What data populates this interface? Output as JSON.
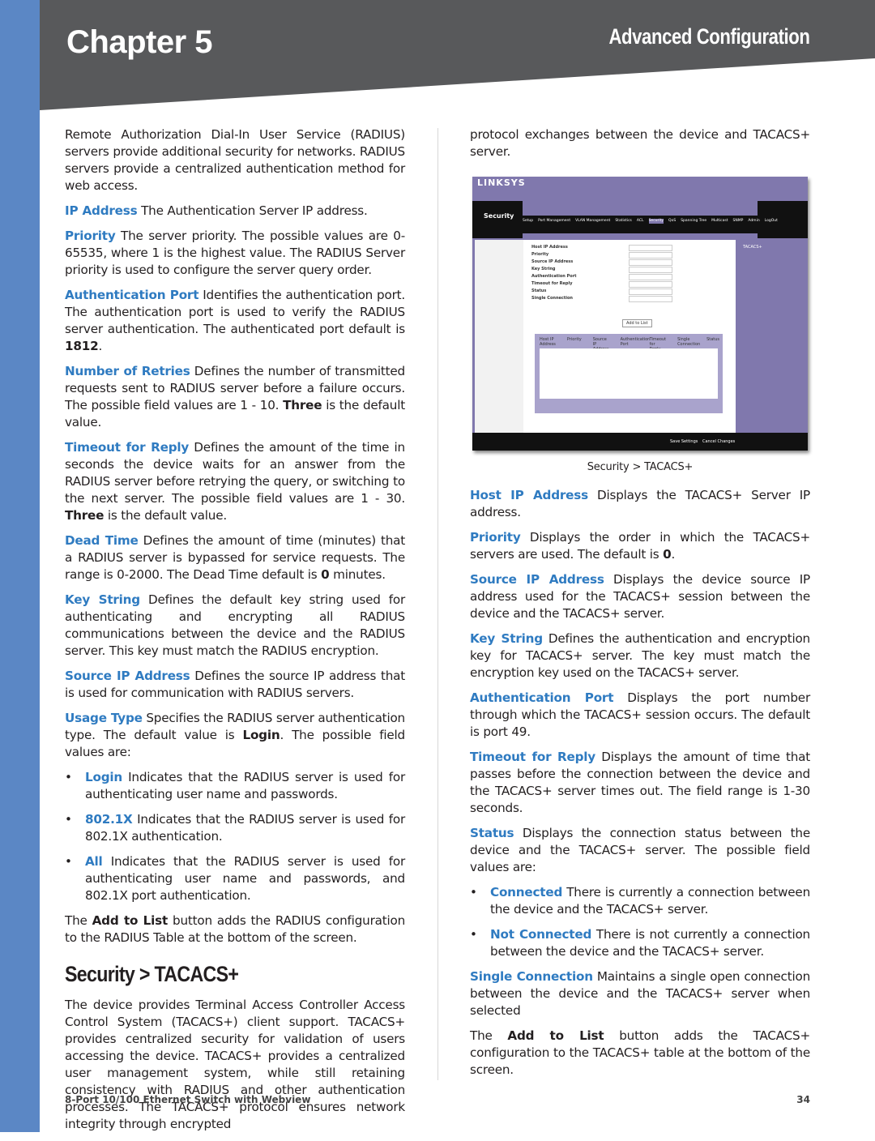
{
  "colors": {
    "strip": "#5b87c5",
    "header": "#58595b",
    "term": "#2f7bc1",
    "embedded_ui": "#8078ad"
  },
  "header": {
    "chapter": "Chapter 5",
    "section": "Advanced Configuration"
  },
  "left": [
    {
      "type": "p",
      "parts": [
        {
          "t": "Remote Authorization Dial-In User Service (RADIUS) servers provide additional security for networks. RADIUS servers provide a centralized authentication method for web access."
        }
      ]
    },
    {
      "type": "p",
      "parts": [
        {
          "t": "IP Address",
          "s": "term"
        },
        {
          "t": "  The Authentication Server IP address."
        }
      ]
    },
    {
      "type": "p",
      "parts": [
        {
          "t": "Priority",
          "s": "term"
        },
        {
          "t": "  The server priority. The possible values are 0-65535, where 1 is the highest value. The RADIUS Server priority is used to configure the server query order."
        }
      ]
    },
    {
      "type": "p",
      "parts": [
        {
          "t": "Authentication Port",
          "s": "term"
        },
        {
          "t": "  Identifies the authentication port. The authentication port is used to verify the RADIUS server authentication. The authenticated port default is "
        },
        {
          "t": "1812",
          "s": "b"
        },
        {
          "t": "."
        }
      ]
    },
    {
      "type": "p",
      "parts": [
        {
          "t": "Number of Retries",
          "s": "term"
        },
        {
          "t": "  Defines the number of transmitted requests sent to RADIUS server before a failure occurs. The possible field values are 1 - 10. "
        },
        {
          "t": "Three",
          "s": "b"
        },
        {
          "t": " is the default value."
        }
      ]
    },
    {
      "type": "p",
      "parts": [
        {
          "t": "Timeout for Reply",
          "s": "term"
        },
        {
          "t": "  Defines the amount of the time in seconds the device waits for an answer from the RADIUS server before retrying the query, or switching to the next server. The possible field values are 1 - 30. "
        },
        {
          "t": "Three",
          "s": "b"
        },
        {
          "t": " is the default value."
        }
      ]
    },
    {
      "type": "p",
      "parts": [
        {
          "t": "Dead Time",
          "s": "term"
        },
        {
          "t": "  Defines the amount of time (minutes) that a RADIUS server is bypassed for service requests. The range is 0-2000. The Dead Time default is "
        },
        {
          "t": "0",
          "s": "b"
        },
        {
          "t": " minutes."
        }
      ]
    },
    {
      "type": "p",
      "parts": [
        {
          "t": "Key String",
          "s": "term"
        },
        {
          "t": "  Defines the default key string used for authenticating and encrypting all RADIUS communications between the device and the RADIUS server. This key must match the RADIUS encryption."
        }
      ]
    },
    {
      "type": "p",
      "parts": [
        {
          "t": "Source IP Address",
          "s": "term"
        },
        {
          "t": "  Defines the source IP address that is used for communication with RADIUS servers."
        }
      ]
    },
    {
      "type": "p",
      "parts": [
        {
          "t": "Usage Type",
          "s": "term"
        },
        {
          "t": "  Specifies the RADIUS server authentication type. The default value is "
        },
        {
          "t": "Login",
          "s": "b"
        },
        {
          "t": ". The possible field values are:"
        }
      ]
    },
    {
      "type": "bullet",
      "parts": [
        {
          "t": "Login",
          "s": "term"
        },
        {
          "t": "  Indicates that the RADIUS server is used for authenticating user name and passwords."
        }
      ]
    },
    {
      "type": "bullet",
      "parts": [
        {
          "t": "802.1X",
          "s": "term"
        },
        {
          "t": "  Indicates that the RADIUS server is used for 802.1X authentication."
        }
      ]
    },
    {
      "type": "bullet",
      "parts": [
        {
          "t": "All",
          "s": "term"
        },
        {
          "t": "  Indicates that the RADIUS server is used for authenticating user name and passwords, and 802.1X port authentication."
        }
      ]
    },
    {
      "type": "p",
      "parts": [
        {
          "t": "The "
        },
        {
          "t": "Add to List",
          "s": "b"
        },
        {
          "t": " button adds the RADIUS configuration to the RADIUS Table at the bottom of the screen."
        }
      ]
    },
    {
      "type": "h2",
      "parts": [
        {
          "t": "Security > TACACS+"
        }
      ]
    },
    {
      "type": "p",
      "parts": [
        {
          "t": "The device provides Terminal Access Controller Access Control System (TACACS+) client support. TACACS+ provides centralized security for validation of users accessing the device. TACACS+ provides a centralized user management system, while still retaining consistency with RADIUS and other authentication processes. The TACACS+ protocol ensures network integrity through encrypted"
        }
      ]
    }
  ],
  "right_top": [
    {
      "type": "p",
      "parts": [
        {
          "t": "protocol exchanges between the device and TACACS+ server."
        }
      ]
    }
  ],
  "screenshot": {
    "logo": "LINKSYS",
    "title": "Security",
    "nav": [
      "Setup",
      "Port Management",
      "VLAN Management",
      "Statistics",
      "ACL",
      "Security",
      "QoS",
      "Spanning Tree",
      "Multicast",
      "SNMP",
      "Admin",
      "LogOut"
    ],
    "fields": [
      "Host IP Address",
      "Priority",
      "Source IP Address",
      "Key String",
      "Authentication Port",
      "Timeout for Reply",
      "Status",
      "Single Connection"
    ],
    "add_button": "Add to List",
    "table_headers": [
      "Host IP Address",
      "Priority",
      "Source IP Address",
      "Authentication Port",
      "Timeout for Reply",
      "Single Connection",
      "Status"
    ],
    "help_title": "TACACS+",
    "save": "Save Settings",
    "cancel": "Cancel Changes",
    "caption": "Security > TACACS+"
  },
  "right": [
    {
      "type": "p",
      "parts": [
        {
          "t": "Host IP Address",
          "s": "term"
        },
        {
          "t": "  Displays the TACACS+ Server IP address."
        }
      ]
    },
    {
      "type": "p",
      "parts": [
        {
          "t": "Priority",
          "s": "term"
        },
        {
          "t": "  Displays the order in which the TACACS+ servers are used. The default is "
        },
        {
          "t": "0",
          "s": "b"
        },
        {
          "t": "."
        }
      ]
    },
    {
      "type": "p",
      "parts": [
        {
          "t": "Source IP Address",
          "s": "term"
        },
        {
          "t": "  Displays the device source IP address used for the TACACS+ session between the device and the TACACS+ server."
        }
      ]
    },
    {
      "type": "p",
      "parts": [
        {
          "t": "Key String",
          "s": "term"
        },
        {
          "t": "  Defines the authentication and encryption key for TACACS+ server. The key must match the encryption key used on the TACACS+ server."
        }
      ]
    },
    {
      "type": "p",
      "parts": [
        {
          "t": "Authentication Port",
          "s": "term"
        },
        {
          "t": "  Displays the port number through which the TACACS+ session occurs. The default is port 49."
        }
      ]
    },
    {
      "type": "p",
      "parts": [
        {
          "t": "Timeout for Reply",
          "s": "term"
        },
        {
          "t": "  Displays the amount of time that passes before the connection between the device and the TACACS+ server times out. The field range is 1-30 seconds."
        }
      ]
    },
    {
      "type": "p",
      "parts": [
        {
          "t": "Status",
          "s": "term"
        },
        {
          "t": "  Displays the connection status between the device and the TACACS+ server. The possible field values are:"
        }
      ]
    },
    {
      "type": "bullet",
      "parts": [
        {
          "t": "Connected",
          "s": "term"
        },
        {
          "t": "  There is currently a connection between the device and the TACACS+ server."
        }
      ]
    },
    {
      "type": "bullet",
      "parts": [
        {
          "t": "Not Connected",
          "s": "term"
        },
        {
          "t": "  There is not currently a connection between the device and the TACACS+ server."
        }
      ]
    },
    {
      "type": "p",
      "parts": [
        {
          "t": "Single Connection",
          "s": "term"
        },
        {
          "t": "  Maintains a single open connection between the device and the TACACS+ server when selected"
        }
      ]
    },
    {
      "type": "p",
      "parts": [
        {
          "t": "The "
        },
        {
          "t": "Add to List",
          "s": "b"
        },
        {
          "t": " button adds the TACACS+ configuration to the TACACS+ table at the bottom of the screen."
        }
      ]
    }
  ],
  "footer": {
    "product": "8-Port 10/100 Ethernet Switch with Webview",
    "page": "34"
  }
}
